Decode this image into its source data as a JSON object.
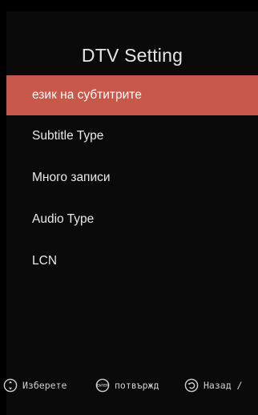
{
  "header": {
    "title": "DTV Setting"
  },
  "menu": {
    "selected_index": 0,
    "items": [
      {
        "label": "език на субтитрите"
      },
      {
        "label": "Subtitle Type"
      },
      {
        "label": "Много записи"
      },
      {
        "label": "Audio Type"
      },
      {
        "label": "LCN"
      }
    ]
  },
  "footer": {
    "hints": [
      {
        "icon": "dpad-icon",
        "label": "Изберете"
      },
      {
        "icon": "enter-icon",
        "icon_text": "ENTER",
        "label": "потвържд"
      },
      {
        "icon": "back-icon",
        "label": "Назад /"
      }
    ]
  },
  "colors": {
    "background": "#000000",
    "highlight": "#c7584a",
    "text": "#e9e9e9"
  }
}
